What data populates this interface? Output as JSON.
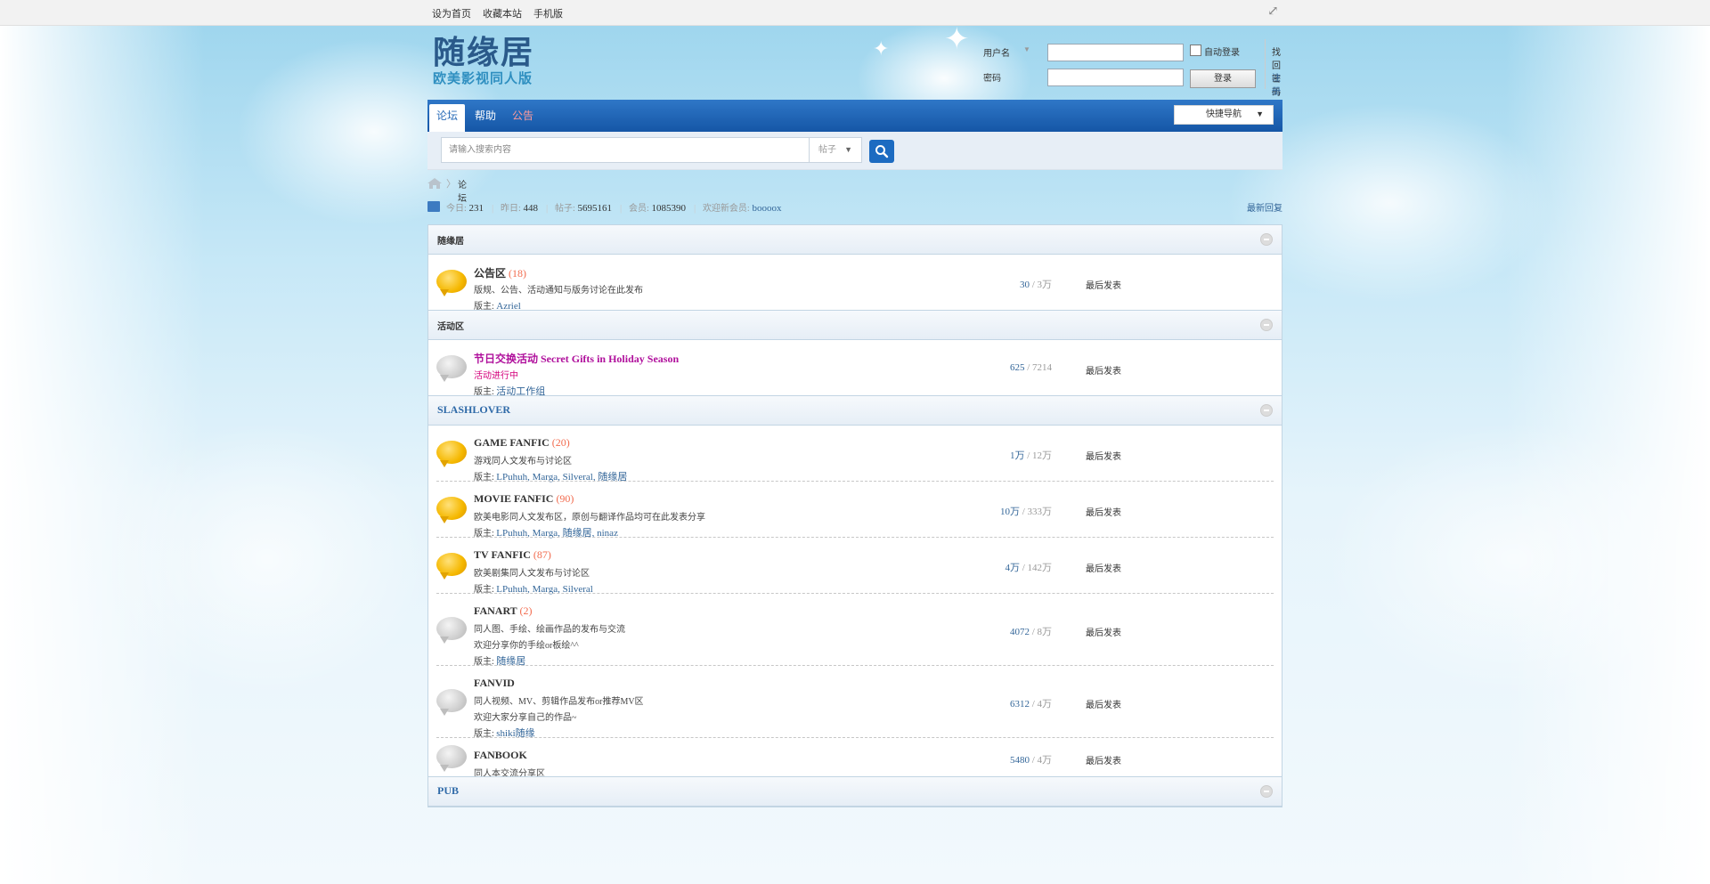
{
  "topbar": {
    "links": [
      "设为首页",
      "收藏本站",
      "手机版"
    ]
  },
  "logo": {
    "line1": "随缘居",
    "line2": "欧美影视同人版"
  },
  "login": {
    "username_label": "用户名",
    "password_label": "密码",
    "autologin_label": "自动登录",
    "login_button": "登录",
    "right_top": "找回密码",
    "right_bottom": "注册"
  },
  "nav": {
    "tabs": [
      "论坛",
      "帮助",
      "公告"
    ],
    "quick_nav": "快捷导航"
  },
  "search": {
    "placeholder": "请输入搜索内容",
    "type": "帖子"
  },
  "breadcrumb": {
    "current": "论坛"
  },
  "stats": {
    "today_label": "今日:",
    "today": "231",
    "yesterday_label": "昨日:",
    "yesterday": "448",
    "posts_label": "帖子:",
    "posts": "5695161",
    "members_label": "会员:",
    "members": "1085390",
    "newest_label": "欢迎新会员:",
    "newest": "boooox",
    "right_link": "最新回复"
  },
  "sections": [
    {
      "title": "随缘居",
      "title_style": "normal",
      "forums": [
        {
          "icon": "yellow",
          "name": "公告区",
          "count": "(18)",
          "lines": [
            "版规、公告、活动通知与版务讨论在此发布"
          ],
          "mods_label": "版主:",
          "mods": "Azriel",
          "num_a": "30",
          "num_b": "3万",
          "last": "最后发表"
        }
      ]
    },
    {
      "title": "活动区",
      "title_style": "normal",
      "forums": [
        {
          "icon": "gray",
          "name": "节日交换活动 Secret Gifts in Holiday Season",
          "name_color": "#b0109c",
          "count": "",
          "lines": [
            "活动进行中"
          ],
          "line_color": "#d4007b",
          "mods_label": "版主:",
          "mods": "活动工作组",
          "num_a": "625",
          "num_b": "7214",
          "last": "最后发表"
        }
      ]
    },
    {
      "title": "SLASHLOVER",
      "title_style": "blue",
      "forums": [
        {
          "icon": "yellow",
          "name": "GAME FANFIC",
          "count": "(20)",
          "lines": [
            "游戏同人文发布与讨论区"
          ],
          "mods_label": "版主:",
          "mods": "LPuhuh, Marga, Silveral, 随缘居",
          "num_a": "1万",
          "num_b": "12万",
          "last": "最后发表"
        },
        {
          "icon": "yellow",
          "name": "MOVIE FANFIC",
          "count": "(90)",
          "lines": [
            "欧美电影同人文发布区，原创与翻译作品均可在此发表分享"
          ],
          "mods_label": "版主:",
          "mods": "LPuhuh, Marga, 随缘居, ninaz",
          "num_a": "10万",
          "num_b": "333万",
          "last": "最后发表"
        },
        {
          "icon": "yellow",
          "name": "TV FANFIC",
          "count": "(87)",
          "lines": [
            "欧美剧集同人文发布与讨论区"
          ],
          "mods_label": "版主:",
          "mods": "LPuhuh, Marga, Silveral",
          "num_a": "4万",
          "num_b": "142万",
          "last": "最后发表"
        },
        {
          "icon": "gray",
          "name": "FANART",
          "count": "(2)",
          "lines": [
            "同人图、手绘、绘画作品的发布与交流",
            "欢迎分享你的手绘or板绘^^"
          ],
          "mods_label": "版主:",
          "mods": "随缘居",
          "num_a": "4072",
          "num_b": "8万",
          "last": "最后发表"
        },
        {
          "icon": "gray",
          "name": "FANVID",
          "count": "",
          "lines": [
            "同人视频、MV、剪辑作品发布or推荐MV区",
            "欢迎大家分享自己的作品~"
          ],
          "mods_label": "版主:",
          "mods": "shiki随缘",
          "num_a": "6312",
          "num_b": "4万",
          "last": "最后发表"
        },
        {
          "icon": "gray",
          "name": "FANBOOK",
          "count": "",
          "lines": [
            "同人本交流分享区"
          ],
          "mods_label": "",
          "mods": "",
          "num_a": "5480",
          "num_b": "4万",
          "last": "最后发表"
        }
      ]
    },
    {
      "title": "PUB",
      "title_style": "blue",
      "forums": []
    }
  ],
  "colors": {
    "nav_blue": "#1c62b4",
    "link_blue": "#336699",
    "count_orange": "#f26c4f"
  }
}
